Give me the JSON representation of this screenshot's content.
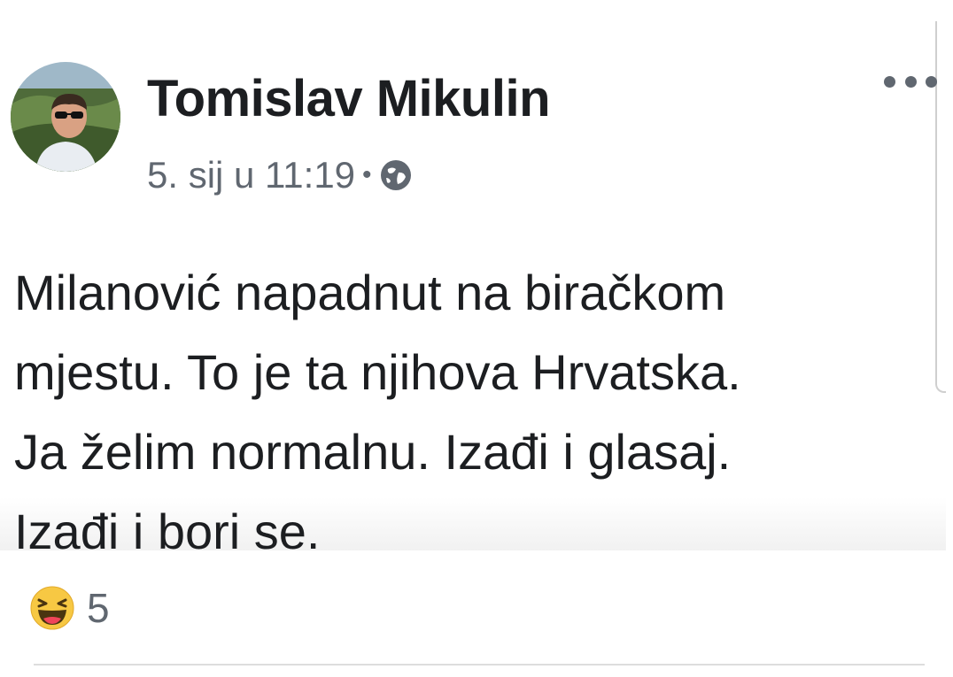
{
  "post": {
    "author": "Tomislav Mikulin",
    "timestamp": "5. sij u 11:19",
    "separator": "•",
    "privacy_icon": "globe-icon",
    "more_icon": "ellipsis-icon",
    "text_lines": [
      "Milanović napadnut na biračkom",
      "mjestu. To je ta njihova Hrvatska.",
      "Ja želim normalnu. Izađi i glasaj.",
      "Izađi i bori se."
    ]
  },
  "reactions": {
    "icon": "haha-reaction-icon",
    "count": "5"
  },
  "colors": {
    "text_primary": "#1c1e21",
    "text_secondary": "#606770",
    "reaction_yellow": "#f7c843"
  }
}
